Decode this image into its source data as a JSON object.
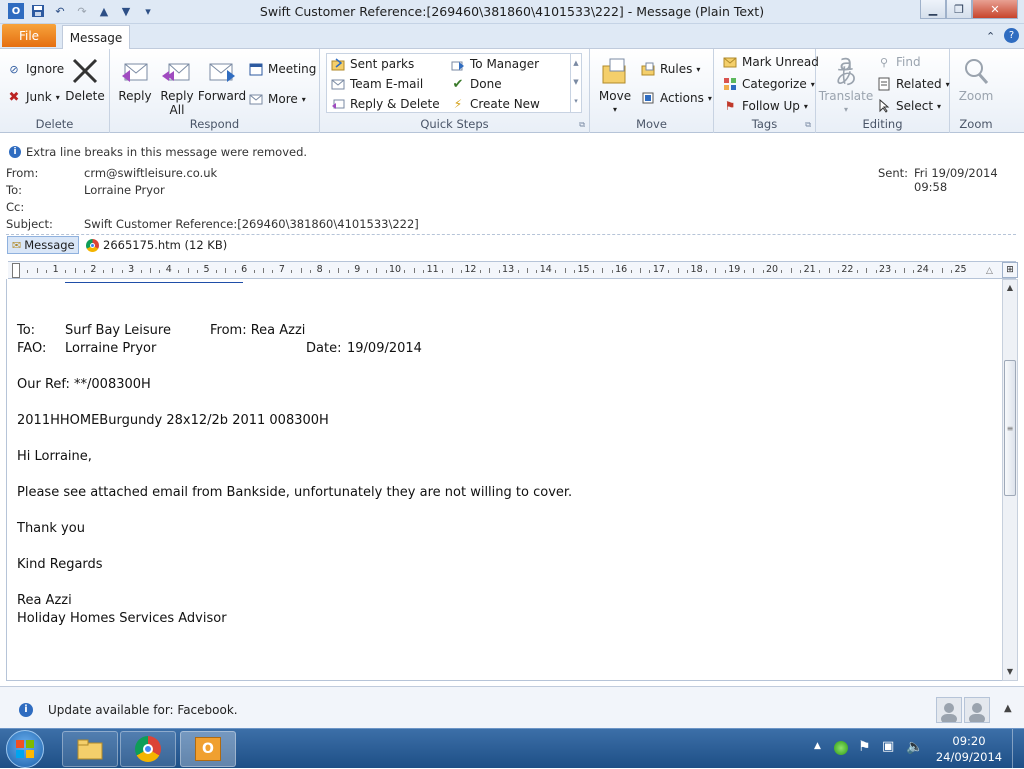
{
  "window": {
    "title": "Swift Customer Reference:[269460\\381860\\4101533\\222]  -  Message (Plain Text)"
  },
  "tabs": {
    "file": "File",
    "message": "Message"
  },
  "ribbon": {
    "delete_group": {
      "label": "Delete",
      "ignore": "Ignore",
      "junk": "Junk",
      "delete": "Delete"
    },
    "respond_group": {
      "label": "Respond",
      "reply": "Reply",
      "reply_all_1": "Reply",
      "reply_all_2": "All",
      "forward": "Forward",
      "meeting": "Meeting",
      "more": "More"
    },
    "quick_steps": {
      "label": "Quick Steps",
      "items": [
        "Sent parks",
        "To Manager",
        "Team E-mail",
        "Done",
        "Reply & Delete",
        "Create New"
      ]
    },
    "move_group": {
      "label": "Move",
      "move": "Move",
      "rules": "Rules",
      "actions": "Actions"
    },
    "tags_group": {
      "label": "Tags",
      "mark_unread": "Mark Unread",
      "categorize": "Categorize",
      "follow_up": "Follow Up"
    },
    "editing_group": {
      "label": "Editing",
      "translate": "Translate",
      "find": "Find",
      "related": "Related",
      "select": "Select"
    },
    "zoom_group": {
      "label": "Zoom",
      "zoom": "Zoom"
    }
  },
  "info_bar": "Extra line breaks in this message were removed.",
  "header": {
    "from_label": "From:",
    "from": "crm@swiftleisure.co.uk",
    "to_label": "To:",
    "to": "Lorraine Pryor",
    "cc_label": "Cc:",
    "cc": "",
    "subject_label": "Subject:",
    "subject": "Swift Customer Reference:[269460\\381860\\4101533\\222]",
    "sent_label": "Sent:",
    "sent": "Fri 19/09/2014 09:58"
  },
  "attachments": {
    "message_tab": "Message",
    "file": "2665175.htm (12 KB)"
  },
  "ruler": [
    "1",
    "2",
    "3",
    "4",
    "5",
    "6",
    "7",
    "8",
    "9",
    "10",
    "11",
    "12",
    "13",
    "14",
    "15",
    "16",
    "17",
    "18",
    "19",
    "20",
    "21",
    "22",
    "23",
    "24",
    "25"
  ],
  "body": {
    "to_label": "To:",
    "to_value": "Surf Bay Leisure",
    "from_label": "From: Rea Azzi",
    "fao_label": "FAO:",
    "fao_value": "Lorraine Pryor",
    "date_label": "Date:",
    "date_value": "19/09/2014",
    "our_ref": "Our Ref: **/008300H",
    "product": "2011HHOMEBurgundy 28x12/2b 2011 008300H",
    "greeting": "Hi Lorraine,",
    "message": "Please see attached email from Bankside, unfortunately they are not willing to cover.",
    "thanks": "Thank you",
    "regards": "Kind Regards",
    "signature_name": "Rea Azzi",
    "signature_title": "Holiday Homes Services Advisor"
  },
  "people_pane": {
    "update_text": "Update available for: Facebook."
  },
  "taskbar": {
    "time": "09:20",
    "date": "24/09/2014"
  },
  "colors": {
    "file_tab": "#e56f12",
    "taskbar": "#1e4f86",
    "ribbon_bg": "#e9eff7"
  }
}
